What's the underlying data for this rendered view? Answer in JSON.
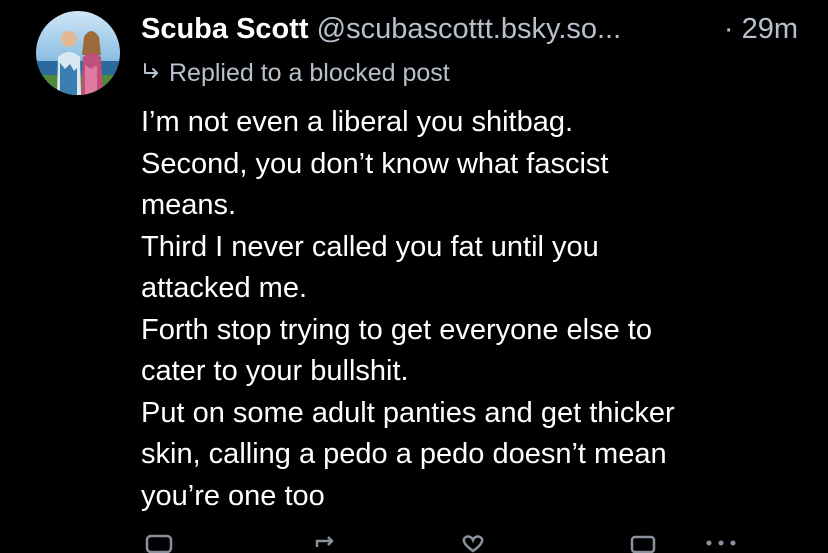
{
  "post": {
    "author_name": "Scuba Scott",
    "author_handle": "@scubascottt.bsky.so...",
    "timestamp": "· 29m",
    "reply_status": "Replied to a blocked post",
    "body_lines": [
      "I’m not even a liberal you shitbag.",
      "Second, you don’t know what fascist",
      "means.",
      "Third I never called you fat until you",
      "attacked me.",
      "Forth stop trying to get everyone else to",
      "cater to your bullshit.",
      "Put on some adult panties and get thicker",
      "skin, calling a pedo a pedo doesn’t mean",
      "you’re one too"
    ],
    "icons": {
      "avatar": "profile-photo",
      "reply_arrow": "reply-arrow-icon",
      "actions": [
        "reply-icon",
        "repost-icon",
        "like-icon",
        "more-icon"
      ]
    },
    "colors": {
      "background": "#000000",
      "text": "#ffffff",
      "muted": "#b8c0cc"
    }
  }
}
